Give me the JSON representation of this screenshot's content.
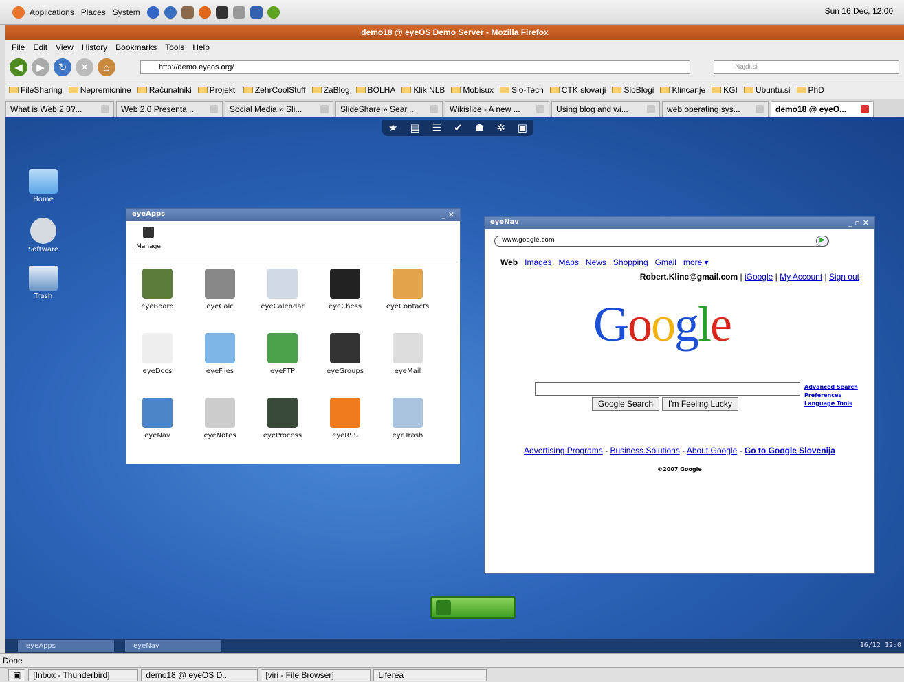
{
  "panel": {
    "menus": [
      "Applications",
      "Places",
      "System"
    ],
    "clock": "Sun 16 Dec, 12:00"
  },
  "firefox": {
    "title": "demo18 @ eyeOS Demo Server - Mozilla Firefox",
    "menu": [
      "File",
      "Edit",
      "View",
      "History",
      "Bookmarks",
      "Tools",
      "Help"
    ],
    "url": "http://demo.eyeos.org/",
    "search_placeholder": "Najdi.si",
    "bookmarks": [
      "FileSharing",
      "Nepremicnine",
      "Računalniki",
      "Projekti",
      "ZehrCoolStuff",
      "ZaBlog",
      "BOLHA",
      "Klik NLB",
      "Mobisux",
      "Slo-Tech",
      "CTK slovarji",
      "SloBlogi",
      "Klincanje",
      "KGI",
      "Ubuntu.si",
      "PhD"
    ],
    "tabs": [
      "What is Web 2.0?...",
      "Web 2.0 Presenta...",
      "Social Media » Sli...",
      "SlideShare » Sear...",
      "Wikislice - A new ...",
      "Using blog and wi...",
      "web operating sys...",
      "demo18 @ eyeO..."
    ],
    "status": "Done"
  },
  "desktop": {
    "icons": [
      "Home",
      "Software",
      "Trash"
    ],
    "eyeapps": {
      "title": "eyeApps",
      "manage": "Manage",
      "apps": [
        "eyeBoard",
        "eyeCalc",
        "eyeCalendar",
        "eyeChess",
        "eyeContacts",
        "eyeDocs",
        "eyeFiles",
        "eyeFTP",
        "eyeGroups",
        "eyeMail",
        "eyeNav",
        "eyeNotes",
        "eyeProcess",
        "eyeRSS",
        "eyeTrash"
      ]
    },
    "eyenav": {
      "title": "eyeNav",
      "url": "www.google.com",
      "gnav": [
        "Web",
        "Images",
        "Maps",
        "News",
        "Shopping",
        "Gmail",
        "more ▾"
      ],
      "user": "Robert.Klinc@gmail.com",
      "ulinks": [
        "iGoogle",
        "My Account",
        "Sign out"
      ],
      "btn1": "Google Search",
      "btn2": "I'm Feeling Lucky",
      "side": [
        "Advanced Search",
        "Preferences",
        "Language Tools"
      ],
      "foot": [
        "Advertising Programs",
        "Business Solutions",
        "About Google",
        "Go to Google Slovenija"
      ],
      "copy": "©2007 Google"
    },
    "taskbar": [
      "eyeApps",
      "eyeNav"
    ],
    "date": "16/12 12:0"
  },
  "gtasks": [
    "[Inbox - Thunderbird]",
    "demo18 @ eyeOS D...",
    "[viri - File Browser]",
    "Liferea"
  ]
}
